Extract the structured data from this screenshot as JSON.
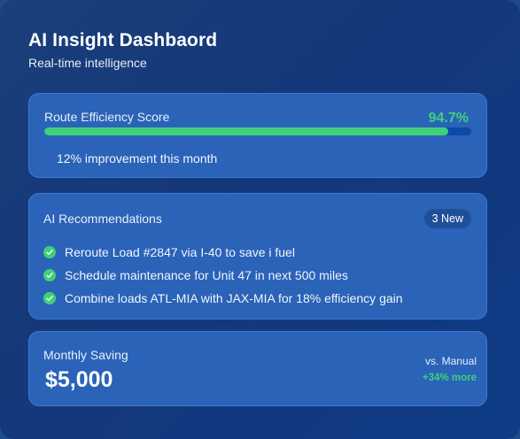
{
  "header": {
    "title": "AI Insight Dashbaord",
    "subtitle": "Real-time intelligence"
  },
  "route_efficiency": {
    "label": "Route Efficiency Score",
    "score_text": "94.7%",
    "score_value": 94.7,
    "improvement": "12% improvement this month"
  },
  "recommendations": {
    "label": "AI Recommendations",
    "badge": "3 New",
    "items": [
      {
        "text": "Reroute Load #2847 via I-40 to save i fuel",
        "icon": "check-circle-icon"
      },
      {
        "text": "Schedule maintenance for Unit 47 in next 500 miles",
        "icon": "check-circle-icon"
      },
      {
        "text": "Combine loads ATL-MIA with JAX-MIA for 18% efficiency gain",
        "icon": "check-circle-icon"
      }
    ]
  },
  "monthly_saving": {
    "label": "Monthly Saving",
    "value": "$5,000",
    "comparison_label": "vs. Manual",
    "delta": "+34% more"
  },
  "colors": {
    "accent_green": "#3ed17a",
    "card_bg": "#2a63b8",
    "track": "#0e4aa8"
  }
}
